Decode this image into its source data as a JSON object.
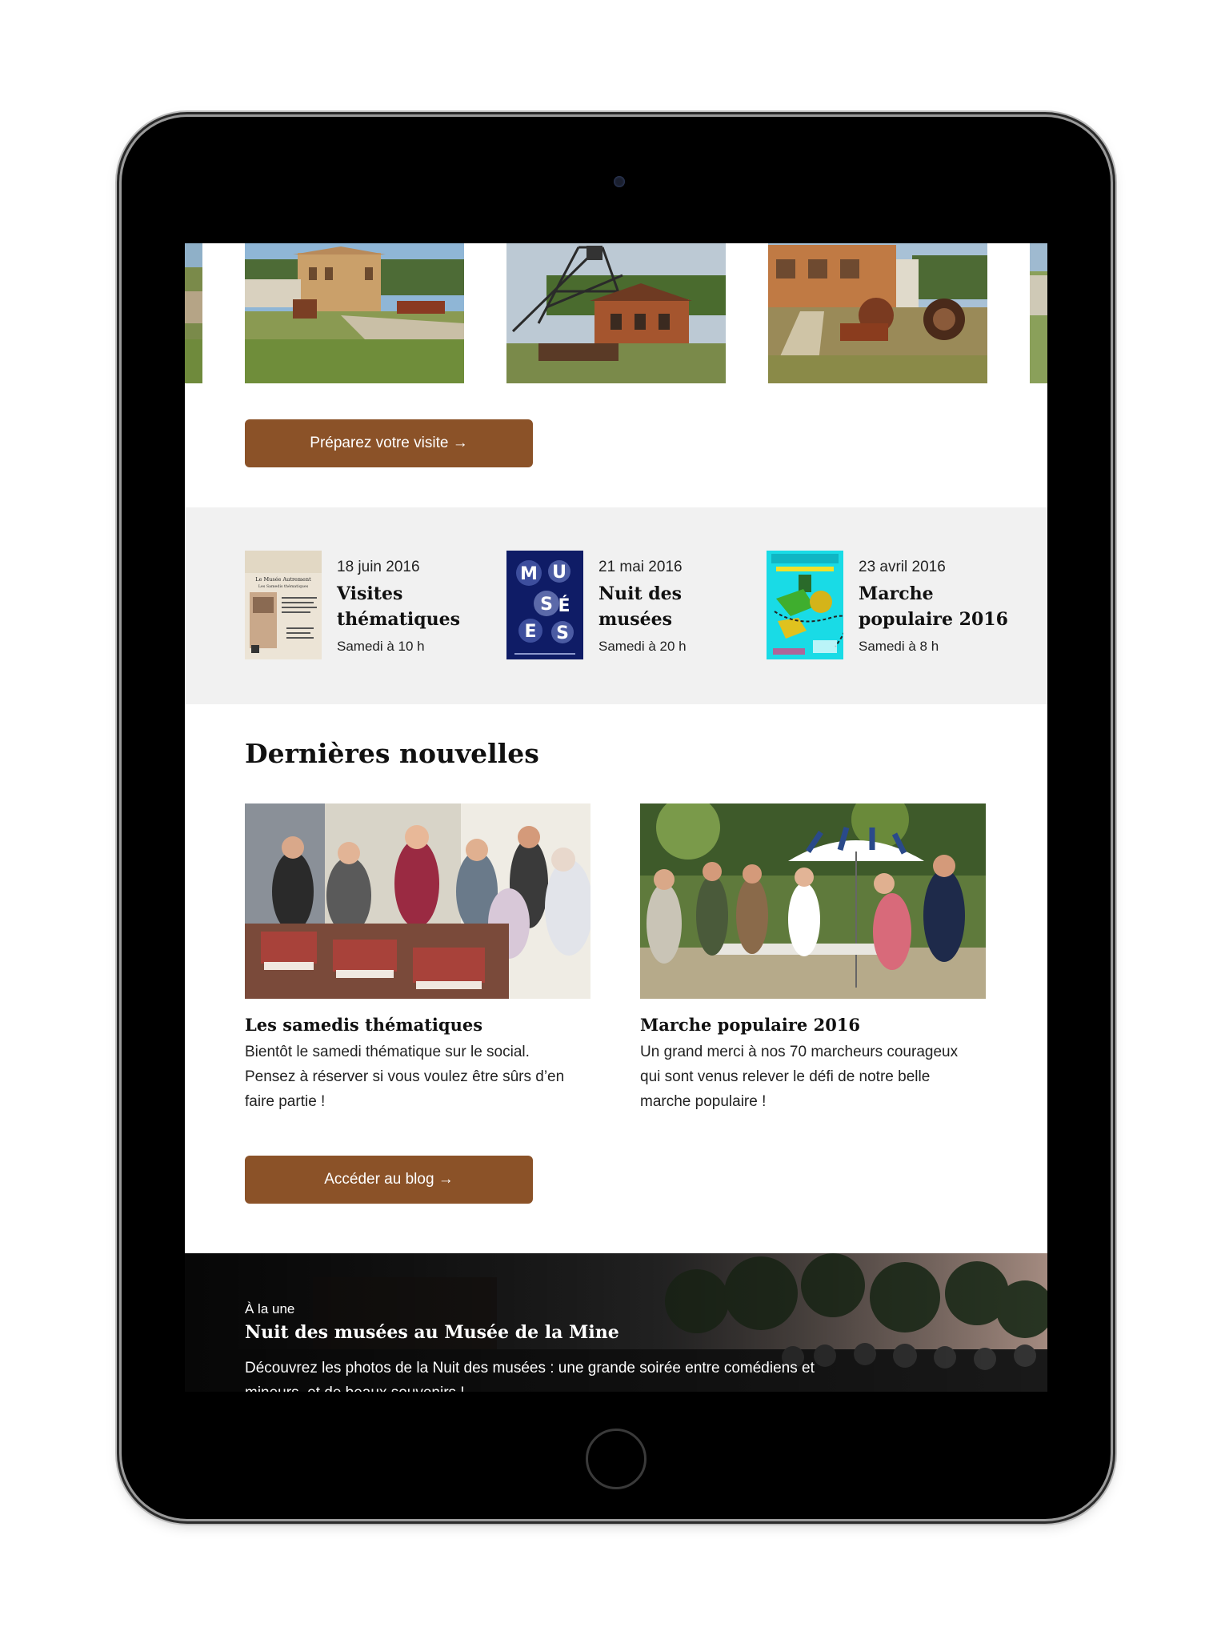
{
  "primary_button": "Préparez votre visite →",
  "events": [
    {
      "date": "18 juin 2016",
      "title_line1": "Visites",
      "title_line2": "thématiques",
      "time": "Samedi à 10 h"
    },
    {
      "date": "21 mai 2016",
      "title_line1": "Nuit des",
      "title_line2": "musées",
      "time": "Samedi à 20 h"
    },
    {
      "date": "23 avril 2016",
      "title_line1": "Marche",
      "title_line2": "populaire 2016",
      "time": "Samedi à 8 h"
    }
  ],
  "posters": {
    "p1_head": "Le Musée Autrement",
    "p1_sub": "Les Samedis thématiques",
    "p2_letters": [
      "M",
      "U",
      "S",
      "É",
      "E",
      "S"
    ]
  },
  "news": {
    "heading": "Dernières nouvelles",
    "items": [
      {
        "title": "Les samedis thématiques",
        "body": "Bientôt le samedi thématique sur le social. Pensez à réserver si vous voulez être sûrs d’en faire partie !"
      },
      {
        "title": "Marche populaire 2016",
        "body": "Un grand merci à nos 70 marcheurs courageux qui sont venus relever le défi de notre belle marche populaire !"
      }
    ],
    "button": "Accéder au blog →"
  },
  "featured": {
    "kicker": "À la une",
    "title": "Nuit des musées au Musée de la Mine",
    "body": "Découvrez les photos de la Nuit des musées : une grande soirée entre comédiens et mineurs, et de beaux souvenirs !"
  },
  "colors": {
    "accent": "#8b5228",
    "band": "#f1f1f1",
    "device": "#000000"
  }
}
